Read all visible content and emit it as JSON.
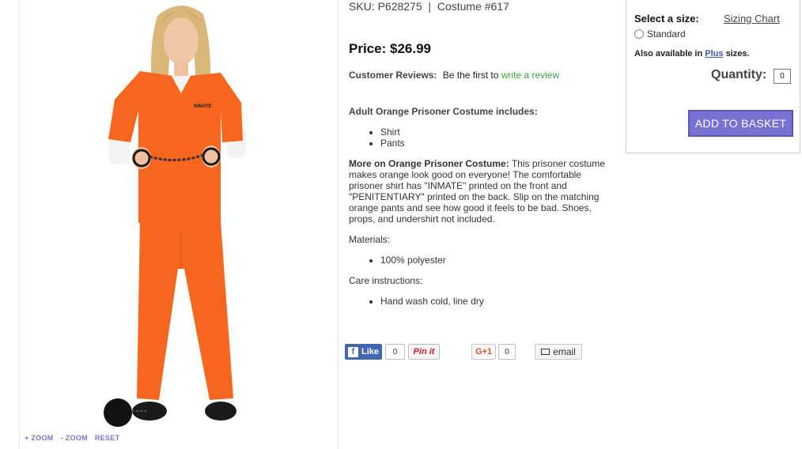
{
  "product": {
    "sku_text": "SKU: P628275",
    "separator": "|",
    "costume_text": "Costume #617",
    "price_label": "Price:",
    "price_value": "$26.99"
  },
  "reviews": {
    "label": "Customer Reviews:",
    "prompt": "Be the first to",
    "link": "write a review"
  },
  "includes": {
    "heading": "Adult Orange Prisoner Costume includes:",
    "items": [
      "Shirt",
      "Pants"
    ]
  },
  "description": {
    "heading": "More on Orange Prisoner Costume:",
    "text": "This prisoner costume makes orange look good on everyone! The comfortable prisoner shirt has \"INMATE\" printed on the front and \"PENITENTIARY\" printed on the back. Slip on the matching orange pants and see how good it feels to be bad. Shoes, props, and undershirt not included."
  },
  "materials": {
    "heading": "Materials:",
    "items": [
      "100% polyester"
    ]
  },
  "care": {
    "heading": "Care instructions:",
    "items": [
      "Hand wash cold, line dry"
    ]
  },
  "image": {
    "shirt_print": "INMATE",
    "zoom_in": "+ ZOOM",
    "zoom_out": "- ZOOM",
    "reset": "RESET"
  },
  "social": {
    "like_icon": "f",
    "like_label": "Like",
    "like_count": "0",
    "pin_label": "Pin it",
    "gplus_label": "G+1",
    "gplus_count": "0",
    "email_label": "email"
  },
  "purchase": {
    "select_size_label": "Select a size:",
    "sizing_chart_link": "Sizing Chart",
    "size_option": "Standard",
    "plus_prefix": "Also available in",
    "plus_link": "Plus",
    "plus_suffix": "sizes.",
    "quantity_label": "Quantity:",
    "quantity_value": "0",
    "add_button": "ADD TO BASKET"
  },
  "colors": {
    "accent_button": "#7872d3",
    "review_link": "#3aa43a",
    "zoom_links": "#7b74c9",
    "costume_orange": "#f7661f"
  }
}
